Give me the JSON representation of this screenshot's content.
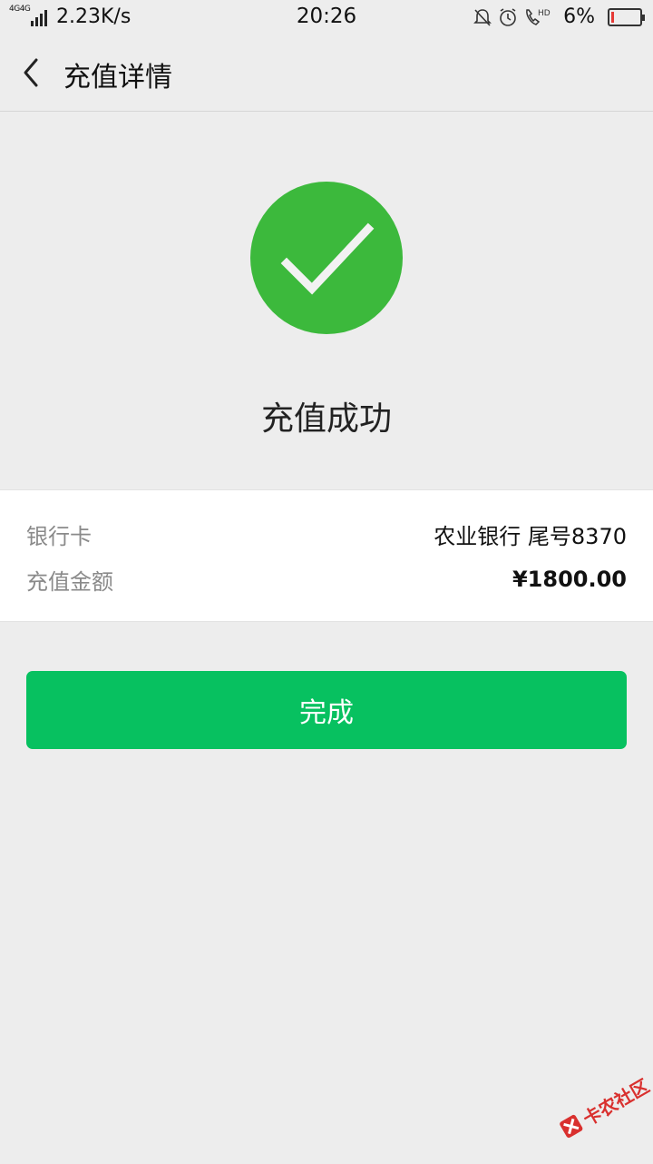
{
  "status_bar": {
    "network_label_1": "4G",
    "network_label_2": "4G",
    "speed": "2.23K/s",
    "time": "20:26",
    "battery": "6%",
    "icons": [
      "mute-icon",
      "alarm-icon",
      "hd-call-icon",
      "battery-icon"
    ]
  },
  "nav": {
    "title": "充值详情",
    "back_icon": "chevron-left-icon"
  },
  "result": {
    "icon": "check-circle-icon",
    "status_text": "充值成功",
    "accent_color": "#3cb93c"
  },
  "details": {
    "bank_label": "银行卡",
    "bank_value": "农业银行 尾号8370",
    "amount_label": "充值金额",
    "amount_value": "¥1800.00"
  },
  "actions": {
    "done_label": "完成",
    "button_color": "#07c160"
  },
  "watermark": {
    "text": "卡农社区"
  }
}
